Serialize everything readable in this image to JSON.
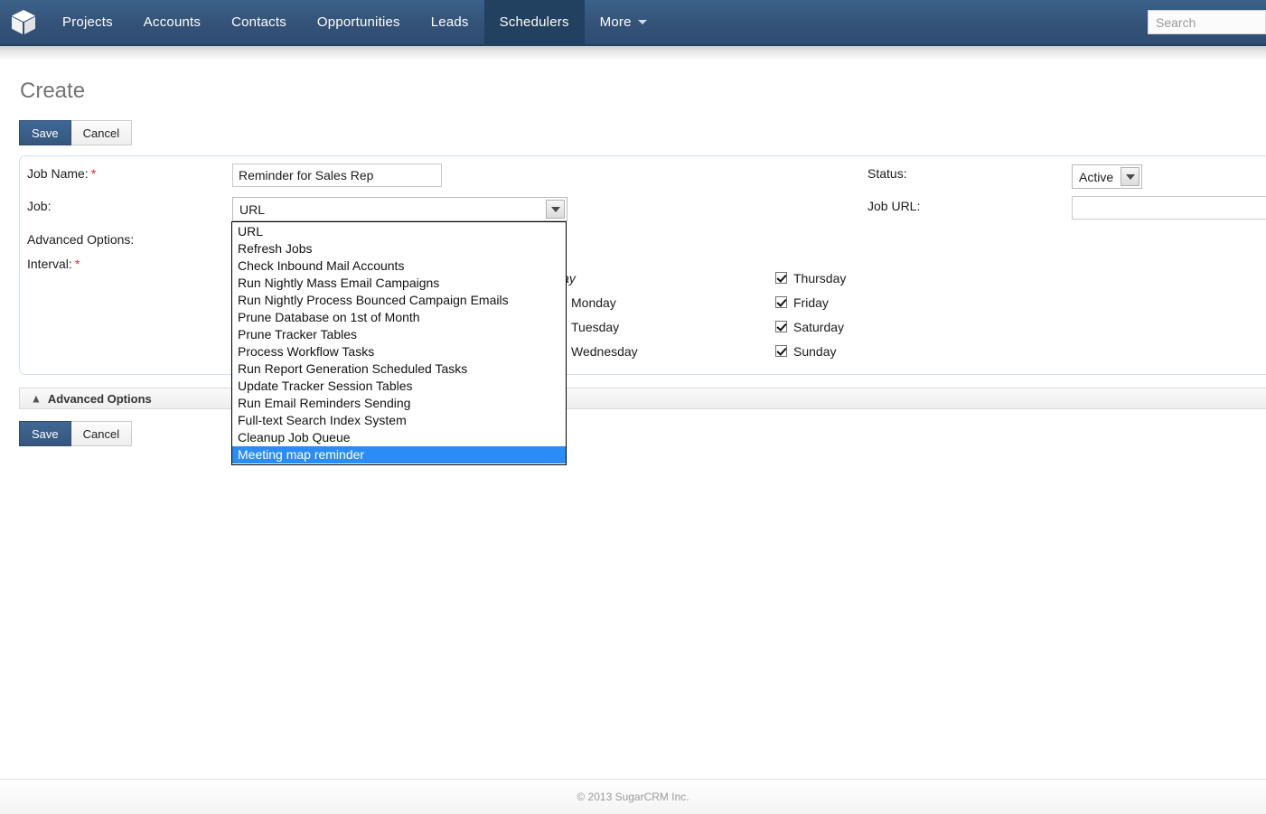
{
  "navbar": {
    "logo_name": "sugarcrm-cube-logo",
    "items": [
      {
        "label": "Projects",
        "active": false
      },
      {
        "label": "Accounts",
        "active": false
      },
      {
        "label": "Contacts",
        "active": false
      },
      {
        "label": "Opportunities",
        "active": false
      },
      {
        "label": "Leads",
        "active": false
      },
      {
        "label": "Schedulers",
        "active": true
      },
      {
        "label": "More",
        "active": false,
        "has_caret": true
      }
    ],
    "search": {
      "placeholder": "Search",
      "value": ""
    },
    "bg_color": "#345277",
    "active_color": "#22405f"
  },
  "page": {
    "title": "Create"
  },
  "actions": {
    "save_label": "Save",
    "cancel_label": "Cancel"
  },
  "form": {
    "job_name": {
      "label": "Job Name:",
      "required": true,
      "value": "Reminder for Sales Rep",
      "placeholder": ""
    },
    "job": {
      "label": "Job:",
      "required": false,
      "selected": "URL",
      "expanded": true,
      "options": [
        "URL",
        "Refresh Jobs",
        "Check Inbound Mail Accounts",
        "Run Nightly Mass Email Campaigns",
        "Run Nightly Process Bounced Campaign Emails",
        "Prune Database on 1st of Month",
        "Prune Tracker Tables",
        "Process Workflow Tasks",
        "Run Report Generation Scheduled Tasks",
        "Update Tracker Session Tables",
        "Run Email Reminders Sending",
        "Full-text Search Index System",
        "Cleanup Job Queue",
        "Meeting map reminder"
      ],
      "highlighted_option": "Meeting map reminder",
      "highlight_color": "#2a8cf4"
    },
    "advanced_options_label": "Advanced Options:",
    "interval": {
      "label": "Interval:",
      "required": true
    },
    "status": {
      "label": "Status:",
      "selected": "Active"
    },
    "job_url": {
      "label": "Job URL:",
      "value": "",
      "placeholder": ""
    },
    "days": {
      "header": "Day",
      "left_column": [
        {
          "label": "Monday",
          "checked": true
        },
        {
          "label": "Tuesday",
          "checked": true
        },
        {
          "label": "Wednesday",
          "checked": true
        }
      ],
      "right_column": [
        {
          "label": "Thursday",
          "checked": true
        },
        {
          "label": "Friday",
          "checked": true
        },
        {
          "label": "Saturday",
          "checked": true
        },
        {
          "label": "Sunday",
          "checked": true
        }
      ]
    }
  },
  "advanced_panel": {
    "label": "Advanced Options",
    "icon": "chevron-double-up-icon",
    "collapsed": false
  },
  "footer": {
    "copyright": "© 2013 SugarCRM Inc."
  }
}
